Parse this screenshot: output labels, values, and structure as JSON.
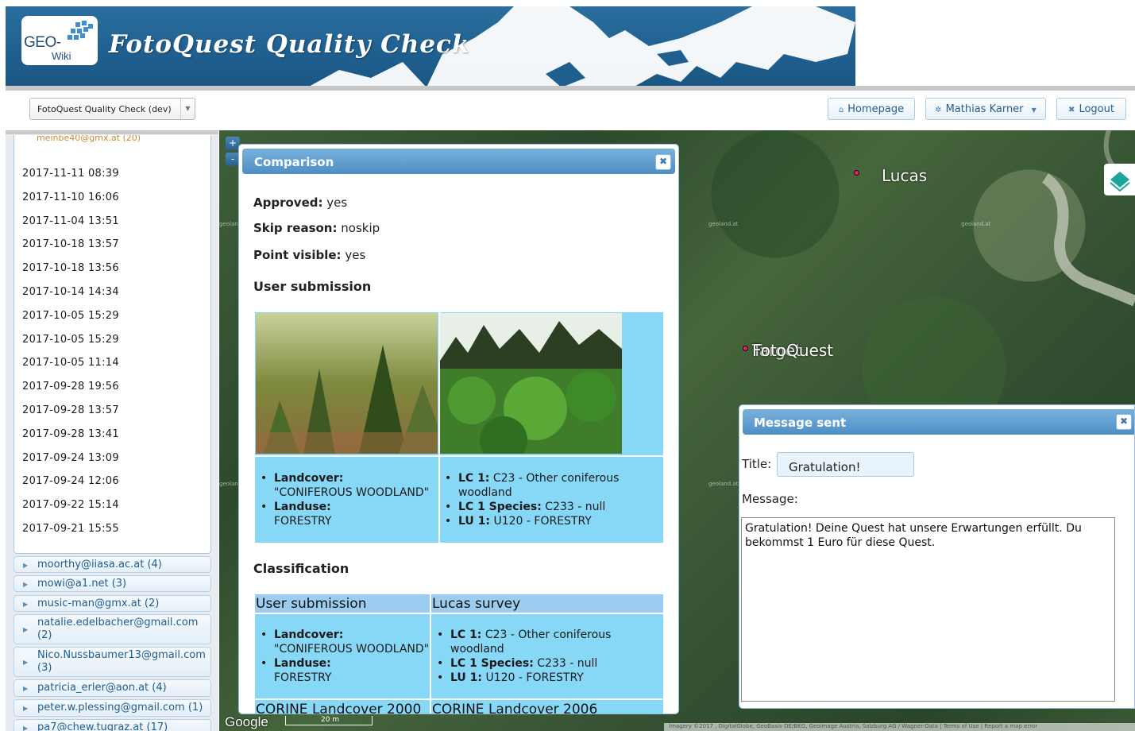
{
  "header": {
    "logo_geo": "GEO-",
    "logo_wiki": "Wiki",
    "app_title": "FotoQuest Quality Check"
  },
  "toolbar": {
    "project_select": "FotoQuest Quality Check (dev)",
    "homepage_label": "Homepage",
    "user_label": "Mathias Karner",
    "logout_label": "Logout"
  },
  "sidebar": {
    "clipped_user": "meinbe40@gmx.at (20)",
    "dates": [
      "2017-11-11 08:39",
      "2017-11-10 16:06",
      "2017-11-04 13:51",
      "2017-10-18 13:57",
      "2017-10-18 13:56",
      "2017-10-14 14:34",
      "2017-10-05 15:29",
      "2017-10-05 15:29",
      "2017-10-05 11:14",
      "2017-09-28 19:56",
      "2017-09-28 13:57",
      "2017-09-28 13:41",
      "2017-09-24 13:09",
      "2017-09-24 12:06",
      "2017-09-22 15:14",
      "2017-09-21 15:55"
    ],
    "users": [
      "moorthy@iiasa.ac.at (4)",
      "mowi@a1.net (3)",
      "music-man@gmx.at (2)",
      "natalie.edelbacher@gmail.com (2)",
      "Nico.Nussbaumer13@gmail.com (3)",
      "patricia_erler@aon.at (4)",
      "peter.w.plessing@gmail.com (1)",
      "pa7@chew.tugraz.at (17)"
    ]
  },
  "map": {
    "zoom_in": "+",
    "zoom_out": "-",
    "label_lucas": "Lucas",
    "label_fotoquest": "FotoQuest",
    "label_target": "Target",
    "google": "Google",
    "scale": "20 m",
    "attribution": "Imagery ©2017 , DigitalGlobe, GeoBasis-DE/BKG, Geoimage Austria, Salzburg AG / Wagner-Data | Terms of Use | Report a map error",
    "tile_text": "geoland.at"
  },
  "comparison": {
    "title": "Comparison",
    "approved_label": "Approved:",
    "approved_value": "yes",
    "skip_label": "Skip reason:",
    "skip_value": "noskip",
    "visible_label": "Point visible:",
    "visible_value": "yes",
    "user_submission_heading": "User submission",
    "submission": {
      "left": {
        "landcover_label": "Landcover:",
        "landcover_value": "\"CONIFEROUS WOODLAND\"",
        "landuse_label": "Landuse:",
        "landuse_value": "FORESTRY"
      },
      "right": {
        "lc1_label": "LC 1:",
        "lc1_value": "C23 - Other coniferous woodland",
        "lc1sp_label": "LC 1 Species:",
        "lc1sp_value": "C233 - null",
        "lu1_label": "LU 1:",
        "lu1_value": "U120 - FORESTRY"
      }
    },
    "classification_heading": "Classification",
    "class_table": {
      "col1_header": "User submission",
      "col2_header": "Lucas survey",
      "left": {
        "landcover_label": "Landcover:",
        "landcover_value": "\"CONIFEROUS WOODLAND\"",
        "landuse_label": "Landuse:",
        "landuse_value": "FORESTRY"
      },
      "right": {
        "lc1_label": "LC 1:",
        "lc1_value": "C23 - Other coniferous woodland",
        "lc1sp_label": "LC 1 Species:",
        "lc1sp_value": "C233 - null",
        "lu1_label": "LU 1:",
        "lu1_value": "U120 - FORESTRY"
      },
      "corine_2000": "CORINE Landcover 2000",
      "corine_2006": "CORINE Landcover 2006"
    }
  },
  "message_dialog": {
    "title": "Message sent",
    "title_label": "Title:",
    "title_value": "Gratulation!",
    "message_label": "Message:",
    "message_value": "Gratulation! Deine Quest hat unsere Erwartungen erfüllt. Du bekommst 1 Euro für diese Quest."
  },
  "colors": {
    "banner_blue": "#1f5f8f",
    "dialog_header": "#4e8ec6",
    "cell_cyan": "#87d7f7",
    "link_blue": "#1f5d8c"
  }
}
